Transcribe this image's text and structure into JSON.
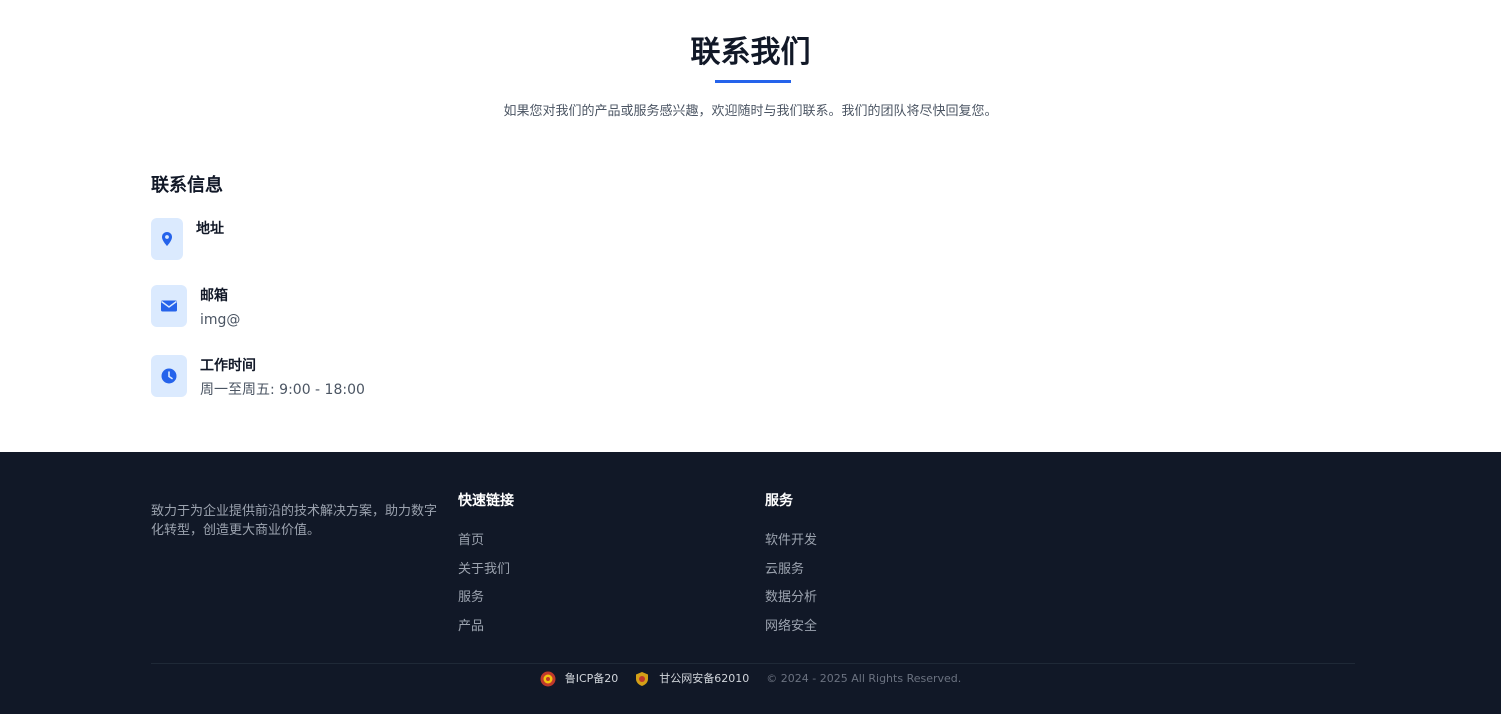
{
  "contact": {
    "title": "联系我们",
    "subtitle": "如果您对我们的产品或服务感兴趣，欢迎随时与我们联系。我们的团队将尽快回复您。",
    "info_heading": "联系信息",
    "items": [
      {
        "icon": "map-pin-icon",
        "label": "地址",
        "value": ""
      },
      {
        "icon": "envelope-icon",
        "label": "邮箱",
        "value": "img@"
      },
      {
        "icon": "clock-icon",
        "label": "工作时间",
        "value": "周一至周五: 9:00 - 18:00"
      }
    ]
  },
  "footer": {
    "description": "致力于为企业提供前沿的技术解决方案，助力数字化转型，创造更大商业价值。",
    "quick_links": {
      "title": "快速链接",
      "links": [
        "首页",
        "关于我们",
        "服务",
        "产品"
      ]
    },
    "services": {
      "title": "服务",
      "links": [
        "软件开发",
        "云服务",
        "数据分析",
        "网络安全"
      ]
    },
    "icp": "鲁ICP备20",
    "police": "甘公网安备62010",
    "copyright": "© 2024 - 2025 All Rights Reserved."
  },
  "colors": {
    "accent": "#2563eb",
    "icon_bg": "#dbeafe",
    "footer_bg": "#111827"
  }
}
